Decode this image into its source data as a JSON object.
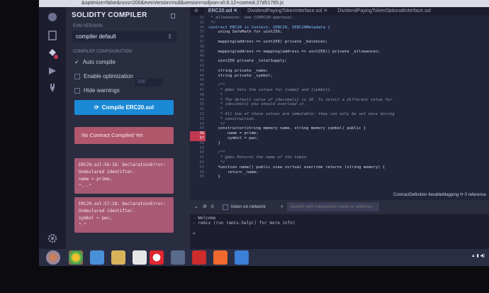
{
  "browser": {
    "url_fragment": "&optimize=false&runs=200&evmVersion=null&version=soljson-v0.6.12+commit.27d51765.js"
  },
  "panel": {
    "title": "SOLIDITY COMPILER",
    "evm_version_label": "EVM VERSION",
    "evm_version_value": "compiler default",
    "compiler_config_label": "COMPILER CONFIGURATION",
    "auto_compile_label": "Auto compile",
    "auto_compile_checked": true,
    "enable_optimization_label": "Enable optimization",
    "enable_optimization_checked": false,
    "optimization_runs": "200",
    "hide_warnings_label": "Hide warnings",
    "hide_warnings_checked": false,
    "compile_button_label": "Compile ERC20.sol",
    "status_message": "No Contract Compiled Yet",
    "errors": [
      {
        "lines": [
          "ERC20.sol:56:16: DeclarationError:",
          "Undeclared identifier.",
          "name = prime;",
          "^---^"
        ]
      },
      {
        "lines": [
          "ERC20.sol:57:18: DeclarationError:",
          "Undeclared identifier.",
          "symbol = pwc;",
          "^-^"
        ]
      }
    ]
  },
  "tabs": [
    {
      "label": "ERC20.sol",
      "active": true
    },
    {
      "label": "DividendPayingTokenInterface.sol",
      "active": false
    },
    {
      "label": "DividendPayingTokenOptionalInterface.sol",
      "active": false
    }
  ],
  "editor": {
    "lines": [
      {
        "n": "31",
        "text": " * allowances. See {IERC20-approve}.",
        "cls": "cm",
        "err": false
      },
      {
        "n": "32",
        "text": " */",
        "cls": "cm",
        "err": false
      },
      {
        "n": "34",
        "text": "contract ERC20 is Context, IERC20, IERC20Metadata {",
        "cls": "kw",
        "err": false
      },
      {
        "n": "35",
        "text": "    using SafeMath for uint256;",
        "cls": "",
        "err": false
      },
      {
        "n": "36",
        "text": "",
        "cls": "",
        "err": false
      },
      {
        "n": "37",
        "text": "    mapping(address => uint256) private _balances;",
        "cls": "",
        "err": false
      },
      {
        "n": "38",
        "text": "",
        "cls": "",
        "err": false
      },
      {
        "n": "39",
        "text": "    mapping(address => mapping(address => uint256)) private _allowances;",
        "cls": "",
        "err": false
      },
      {
        "n": "40",
        "text": "",
        "cls": "",
        "err": false
      },
      {
        "n": "41",
        "text": "    uint256 private _totalSupply;",
        "cls": "",
        "err": false
      },
      {
        "n": "42",
        "text": "",
        "cls": "",
        "err": false
      },
      {
        "n": "43",
        "text": "    string private _name;",
        "cls": "",
        "err": false
      },
      {
        "n": "44",
        "text": "    string private _symbol;",
        "cls": "",
        "err": false
      },
      {
        "n": "45",
        "text": "",
        "cls": "",
        "err": false
      },
      {
        "n": "46",
        "text": "    /**",
        "cls": "cm",
        "err": false
      },
      {
        "n": "47",
        "text": "     * @dev Sets the values for {name} and {symbol}.",
        "cls": "cm",
        "err": false
      },
      {
        "n": "48",
        "text": "     *",
        "cls": "cm",
        "err": false
      },
      {
        "n": "49",
        "text": "     * The default value of {decimals} is 18. To select a different value for",
        "cls": "cm",
        "err": false
      },
      {
        "n": "50",
        "text": "     * {decimals} you should overload it.",
        "cls": "cm",
        "err": false
      },
      {
        "n": "51",
        "text": "     *",
        "cls": "cm",
        "err": false
      },
      {
        "n": "52",
        "text": "     * All two of these values are immutable: they can only be set once during",
        "cls": "cm",
        "err": false
      },
      {
        "n": "53",
        "text": "     * construction.",
        "cls": "cm",
        "err": false
      },
      {
        "n": "54",
        "text": "     */",
        "cls": "cm",
        "err": false
      },
      {
        "n": "55",
        "text": "    constructor(string memory name, string memory symbol) public {",
        "cls": "",
        "err": false
      },
      {
        "n": "56",
        "text": "        name = prime;",
        "cls": "",
        "err": true
      },
      {
        "n": "57",
        "text": "        symbol = pwc;",
        "cls": "",
        "err": true
      },
      {
        "n": "58",
        "text": "    }",
        "cls": "",
        "err": false
      },
      {
        "n": "59",
        "text": "",
        "cls": "",
        "err": false
      },
      {
        "n": "60",
        "text": "    /**",
        "cls": "cm",
        "err": false
      },
      {
        "n": "61",
        "text": "     * @dev Returns the name of the token.",
        "cls": "cm",
        "err": false
      },
      {
        "n": "62",
        "text": "     */",
        "cls": "cm",
        "err": false
      },
      {
        "n": "63",
        "text": "    function name() public view virtual override returns (string memory) {",
        "cls": "",
        "err": false
      },
      {
        "n": "64",
        "text": "        return _name;",
        "cls": "",
        "err": false
      },
      {
        "n": "65",
        "text": "    }",
        "cls": "",
        "err": false
      }
    ]
  },
  "info_line": "ContractDefinition IterableMapping  ⟳  0 reference",
  "terminal": {
    "pending_count": "0",
    "listen_label": "listen on network",
    "search_placeholder": "Search with transaction hash or address",
    "lines": [
      "  - Welcome",
      "  - remix (run remix.help() for more info)"
    ]
  },
  "colors": {
    "accent": "#1a8ad6",
    "error": "#c0394f",
    "panel": "#2a2c3f",
    "editor": "#22243a"
  }
}
